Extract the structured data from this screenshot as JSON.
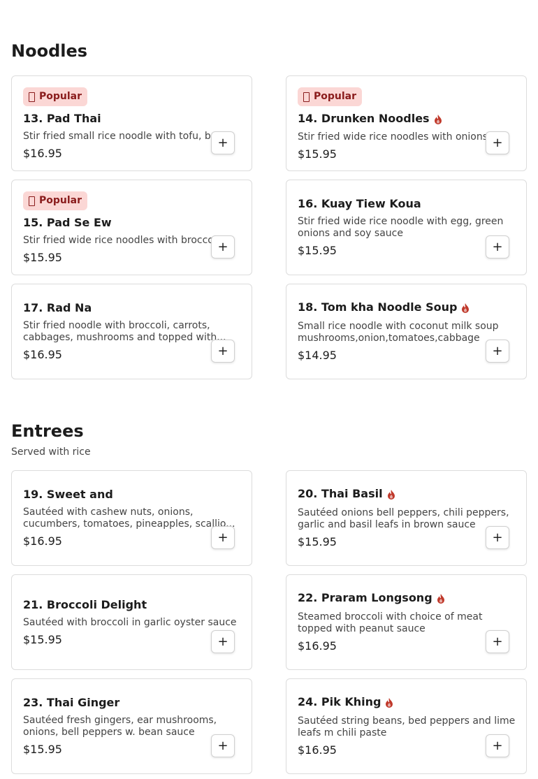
{
  "sections": [
    {
      "title": "Noodles",
      "subtitle": "",
      "items": [
        {
          "badge": "Popular",
          "name": "13. Pad Thai",
          "spicy": false,
          "description": "Stir fried small rice noodle with tofu, b...",
          "price": "$16.95",
          "add_label": "+"
        },
        {
          "badge": "Popular",
          "name": "14. Drunken Noodles",
          "spicy": true,
          "description": "Stir fried wide rice noodles with onions...",
          "price": "$15.95",
          "add_label": "+"
        },
        {
          "badge": "Popular",
          "name": "15. Pad Se Ew",
          "spicy": false,
          "description": "Stir fried wide rice noodles with broccoli...",
          "price": "$15.95",
          "add_label": "+"
        },
        {
          "badge": "",
          "name": "16. Kuay Tiew Koua",
          "spicy": false,
          "description": "Stir fried wide rice noodle with egg, green onions and soy sauce",
          "price": "$15.95",
          "add_label": "+"
        },
        {
          "badge": "",
          "name": "17. Rad Na",
          "spicy": false,
          "description": "Stir fried noodle with broccoli, carrots, cabbages, mushrooms and topped with...",
          "price": "$16.95",
          "add_label": "+"
        },
        {
          "badge": "",
          "name": "18. Tom kha Noodle Soup",
          "spicy": true,
          "description": "Small rice noodle with coconut milk soup mushrooms,onion,tomatoes,cabbage ,carro...",
          "price": "$14.95",
          "add_label": "+"
        }
      ]
    },
    {
      "title": "Entrees",
      "subtitle": "Served with rice",
      "items": [
        {
          "badge": "",
          "name": "19. Sweet and",
          "spicy": false,
          "description": "Sautéed with cashew nuts, onions, cucumbers, tomatoes, pineapples, scallio...",
          "price": "$16.95",
          "add_label": "+"
        },
        {
          "badge": "",
          "name": "20. Thai Basil",
          "spicy": true,
          "description": "Sautéed onions bell peppers, chili peppers, garlic and basil leafs in brown sauce",
          "price": "$15.95",
          "add_label": "+"
        },
        {
          "badge": "",
          "name": "21. Broccoli Delight",
          "spicy": false,
          "description": "Sautéed with broccoli in garlic oyster sauce",
          "price": "$15.95",
          "add_label": "+"
        },
        {
          "badge": "",
          "name": "22. Praram Longsong",
          "spicy": true,
          "description": "Steamed broccoli with choice of meat topped with peanut sauce",
          "price": "$16.95",
          "add_label": "+"
        },
        {
          "badge": "",
          "name": "23. Thai Ginger",
          "spicy": false,
          "description": "Sautéed fresh gingers, ear mushrooms, onions, bell peppers w. bean sauce",
          "price": "$15.95",
          "add_label": "+"
        },
        {
          "badge": "",
          "name": "24. Pik Khing",
          "spicy": true,
          "description": "Sautéed string beans, bed peppers and lime leafs m chili paste",
          "price": "$16.95",
          "add_label": "+"
        }
      ]
    }
  ],
  "colors": {
    "badge_bg": "#fbd7d5",
    "badge_text": "#8a1c1c",
    "spicy_icon": "#c0392b",
    "card_border": "#dcdcdc"
  }
}
